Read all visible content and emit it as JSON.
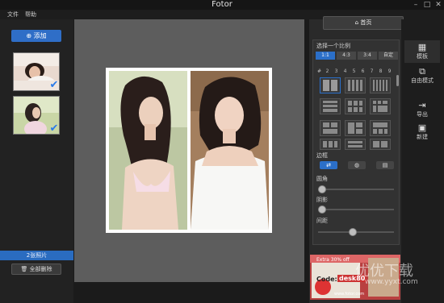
{
  "app": {
    "title": "Fotor"
  },
  "window_controls": {
    "minimize": "–",
    "maximize": "□",
    "close": "✕"
  },
  "menu": {
    "file": "文件",
    "help": "帮助"
  },
  "left": {
    "add_label": "添加",
    "photo_count": "2张照片",
    "remove_all": "全部删除"
  },
  "right": {
    "home_label": "首页",
    "ratio_heading": "选择一个比例",
    "ratios": [
      "1:1",
      "4:3",
      "3:4",
      "自定"
    ],
    "numbers": [
      "#",
      "2",
      "3",
      "4",
      "5",
      "6",
      "7",
      "8",
      "9"
    ],
    "border_heading": "边框",
    "corner_label": "圆角",
    "shadow_label": "阴影",
    "spacing_label": "间距",
    "sliders": {
      "corner": 0,
      "shadow": 0,
      "spacing": 0.45
    }
  },
  "toolbar": {
    "template": "模板",
    "freestyle": "自由模式",
    "export": "导出",
    "new": "新建"
  },
  "ad": {
    "discount": "Extra 30% off",
    "code_label": "Code:",
    "code": "desk80",
    "url": "www.fotor.com"
  },
  "watermark": {
    "text": "优优下载",
    "url": "www.yyxt.com"
  },
  "colors": {
    "accent": "#2b6fc8",
    "background": "#1b1b1b",
    "canvas": "#5d5d5d"
  },
  "icons": {
    "home": "home-icon",
    "add": "plus-circle-icon",
    "check": "check-icon",
    "template": "template-icon",
    "freestyle": "freestyle-icon",
    "export": "export-icon",
    "new": "new-icon"
  }
}
